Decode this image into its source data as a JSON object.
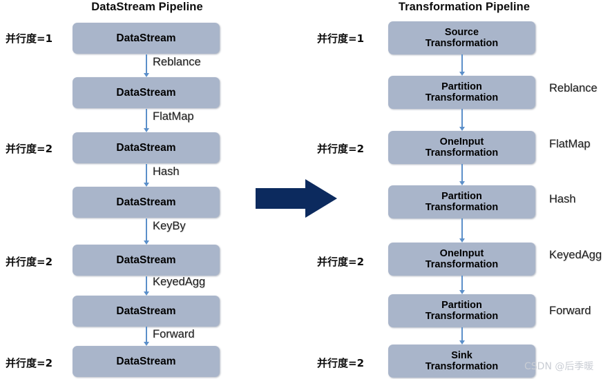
{
  "titles": {
    "left": "DataStream Pipeline",
    "right": "Transformation Pipeline"
  },
  "left_pipeline": {
    "name": "DataStream Pipeline",
    "nodes": [
      {
        "label": "DataStream",
        "parallelism": "并行度=1"
      },
      {
        "label": "DataStream",
        "parallelism": ""
      },
      {
        "label": "DataStream",
        "parallelism": "并行度=2"
      },
      {
        "label": "DataStream",
        "parallelism": ""
      },
      {
        "label": "DataStream",
        "parallelism": "并行度=2"
      },
      {
        "label": "DataStream",
        "parallelism": ""
      },
      {
        "label": "DataStream",
        "parallelism": "并行度=2"
      }
    ],
    "edges": [
      "Reblance",
      "FlatMap",
      "Hash",
      "KeyBy",
      "KeyedAgg",
      "Forward"
    ]
  },
  "right_pipeline": {
    "name": "Transformation Pipeline",
    "nodes": [
      {
        "line1": "Source",
        "line2": "Transformation",
        "parallelism": "并行度=1"
      },
      {
        "line1": "Partition",
        "line2": "Transformation",
        "parallelism": ""
      },
      {
        "line1": "OneInput",
        "line2": "Transformation",
        "parallelism": "并行度=2"
      },
      {
        "line1": "Partition",
        "line2": "Transformation",
        "parallelism": ""
      },
      {
        "line1": "OneInput",
        "line2": "Transformation",
        "parallelism": "并行度=2"
      },
      {
        "line1": "Partition",
        "line2": "Transformation",
        "parallelism": ""
      },
      {
        "line1": "Sink",
        "line2": "Transformation",
        "parallelism": "并行度=2"
      }
    ],
    "edges": [
      "Reblance",
      "FlatMap",
      "Hash",
      "KeyedAgg",
      "Forward"
    ]
  },
  "transition_arrow": {
    "direction": "right"
  },
  "watermark": "CSDN @后季暖",
  "colors": {
    "node_fill": "#a9b5ca",
    "connector": "#5b8fc9",
    "big_arrow": "#0c2a5e",
    "text": "#0d0d0d",
    "watermark": "#c9cdd4",
    "background": "#ffffff"
  }
}
